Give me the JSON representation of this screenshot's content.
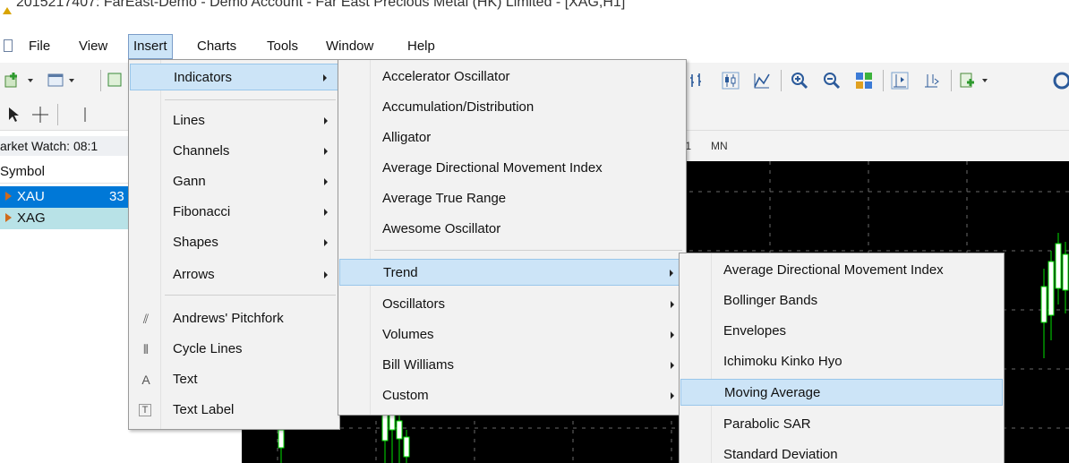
{
  "window_title": "2015217407: FarEast-Demo - Demo Account - Far East Precious Metal (HK) Limited - [XAG,H1]",
  "menubar": {
    "items": [
      "File",
      "View",
      "Insert",
      "Charts",
      "Tools",
      "Window",
      "Help"
    ],
    "active": "Insert"
  },
  "market_watch": {
    "title": "arket Watch: 08:1",
    "header": "Symbol",
    "rows": [
      {
        "symbol": "XAU",
        "value": "33"
      },
      {
        "symbol": "XAG",
        "value": ""
      }
    ]
  },
  "timeframes": [
    "/1",
    "MN"
  ],
  "insert_menu": {
    "items": [
      {
        "label": "Indicators",
        "submenu": true
      },
      {
        "label": "Lines",
        "submenu": true
      },
      {
        "label": "Channels",
        "submenu": true
      },
      {
        "label": "Gann",
        "submenu": true
      },
      {
        "label": "Fibonacci",
        "submenu": true
      },
      {
        "label": "Shapes",
        "submenu": true
      },
      {
        "label": "Arrows",
        "submenu": true
      },
      {
        "label": "Andrews' Pitchfork",
        "icon": "pitchfork-icon"
      },
      {
        "label": "Cycle Lines",
        "icon": "cycle-lines-icon"
      },
      {
        "label": "Text",
        "icon": "text-icon"
      },
      {
        "label": "Text Label",
        "icon": "text-label-icon"
      }
    ]
  },
  "indicators_menu": {
    "items": [
      "Accelerator Oscillator",
      "Accumulation/Distribution",
      "Alligator",
      "Average Directional Movement Index",
      "Average True Range",
      "Awesome Oscillator",
      "Trend",
      "Oscillators",
      "Volumes",
      "Bill Williams",
      "Custom"
    ]
  },
  "trend_menu": {
    "items": [
      "Average Directional Movement Index",
      "Bollinger Bands",
      "Envelopes",
      "Ichimoku Kinko Hyo",
      "Moving Average",
      "Parabolic SAR",
      "Standard Deviation"
    ],
    "highlighted": "Moving Average"
  },
  "colors": {
    "menu_highlight": "#cce4f7",
    "selected_row": "#0078d7",
    "chart_bg": "#000000",
    "candle": "#00e000"
  }
}
